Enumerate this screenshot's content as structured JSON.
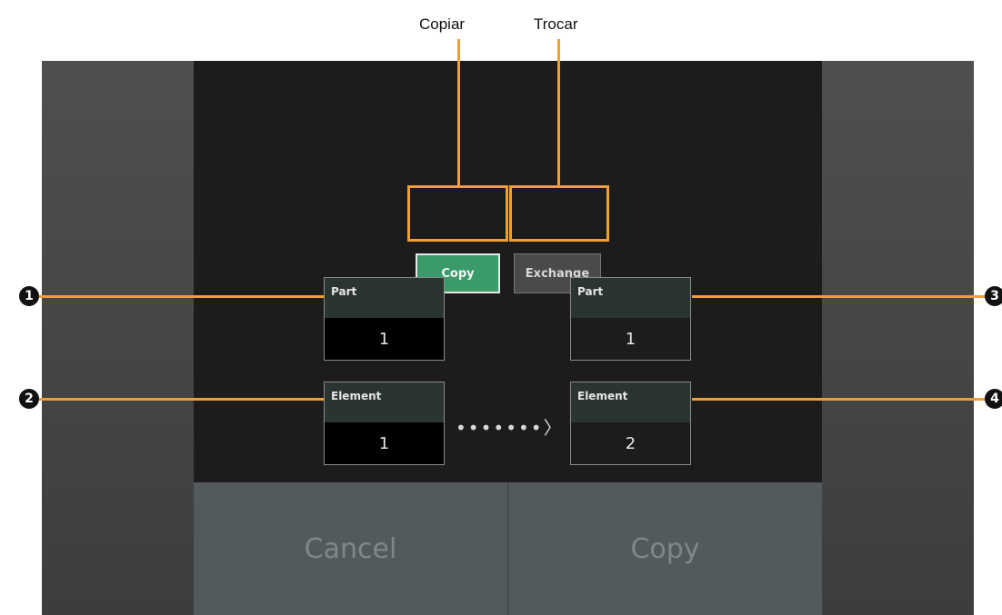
{
  "callouts": {
    "copiar": "Copiar",
    "trocar": "Trocar",
    "markers": [
      "1",
      "2",
      "3",
      "4"
    ]
  },
  "mode_buttons": {
    "copy_label": "Copy",
    "exchange_label": "Exchange",
    "selected": "Copy"
  },
  "source": {
    "part_label": "Part",
    "part_value": "1",
    "element_label": "Element",
    "element_value": "1"
  },
  "destination": {
    "part_label": "Part",
    "part_value": "1",
    "element_label": "Element",
    "element_value": "2"
  },
  "arrow_text": "•••••••〉",
  "footer": {
    "cancel_label": "Cancel",
    "copy_label": "Copy"
  },
  "colors": {
    "highlight": "#f0a030",
    "selected_button": "#3a9a6a",
    "unselected_button": "#4a4a4a"
  }
}
